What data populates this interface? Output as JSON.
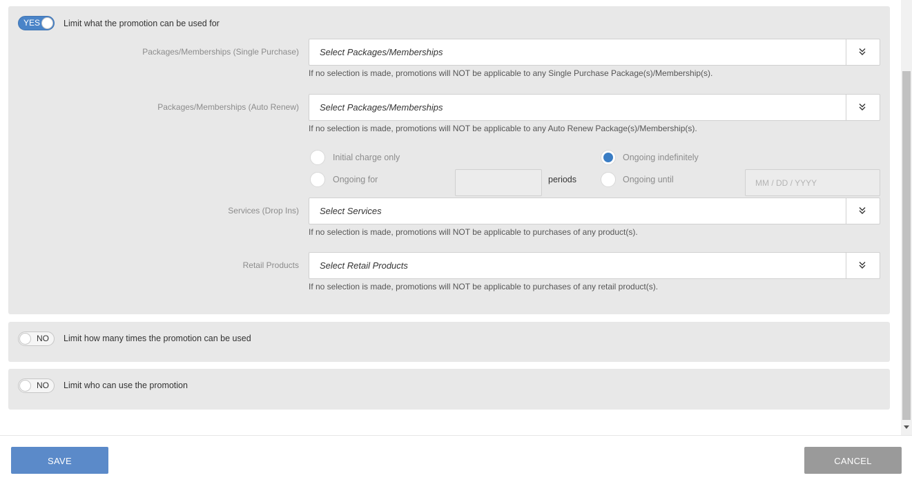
{
  "sections": {
    "limit_use": {
      "toggle_label": "YES",
      "title": "Limit what the promotion can be used for",
      "packages_single": {
        "label": "Packages/Memberships (Single Purchase)",
        "placeholder": "Select Packages/Memberships",
        "hint": "If no selection is made, promotions will NOT be applicable to any Single Purchase Package(s)/Membership(s)."
      },
      "packages_auto": {
        "label": "Packages/Memberships (Auto Renew)",
        "placeholder": "Select Packages/Memberships",
        "hint": "If no selection is made, promotions will NOT be applicable to any Auto Renew Package(s)/Membership(s)."
      },
      "charge_options": {
        "initial_only": "Initial charge only",
        "ongoing_indefinitely": "Ongoing indefinitely",
        "ongoing_for": "Ongoing for",
        "periods_value": "",
        "periods_label": "periods",
        "ongoing_until": "Ongoing until",
        "date_placeholder": "MM / DD / YYYY",
        "selected": "ongoing_indefinitely"
      },
      "services": {
        "label": "Services (Drop Ins)",
        "placeholder": "Select Services",
        "hint": "If no selection is made, promotions will NOT be applicable to purchases of any product(s)."
      },
      "retail": {
        "label": "Retail Products",
        "placeholder": "Select Retail Products",
        "hint": "If no selection is made, promotions will NOT be applicable to purchases of any retail product(s)."
      }
    },
    "limit_times": {
      "toggle_label": "NO",
      "title": "Limit how many times the promotion can be used"
    },
    "limit_who": {
      "toggle_label": "NO",
      "title": "Limit who can use the promotion"
    }
  },
  "footer": {
    "save_label": "SAVE",
    "cancel_label": "CANCEL"
  },
  "colors": {
    "accent": "#4a84c8",
    "save_button": "#5b8ac9",
    "cancel_button": "#9a9a9a",
    "panel_bg": "#e8e8e8"
  },
  "icons": {
    "select_chevron": "double-chevron-down-icon"
  }
}
